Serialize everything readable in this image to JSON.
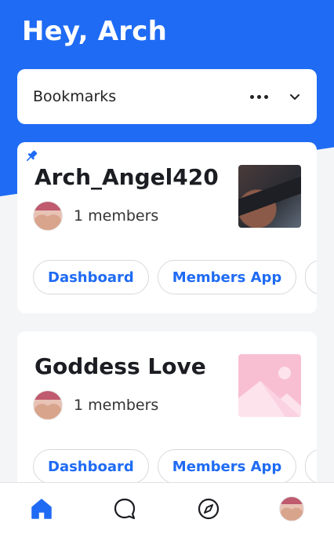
{
  "header": {
    "greeting": "Hey, Arch"
  },
  "selector": {
    "label": "Bookmarks",
    "more_icon": "more-icon",
    "chevron_icon": "chevron-down-icon"
  },
  "colors": {
    "brand": "#1f6bf4",
    "placeholder_pink": "#f8bfd3"
  },
  "cards": [
    {
      "title": "Arch_Angel420",
      "members": "1 members",
      "pinned": true,
      "pills": [
        "Dashboard",
        "Members App"
      ]
    },
    {
      "title": "Goddess Love",
      "members": "1 members",
      "pinned": false,
      "pills": [
        "Dashboard",
        "Members App"
      ]
    }
  ],
  "nav": {
    "items": [
      "home-icon",
      "chat-icon",
      "compass-icon",
      "profile-avatar"
    ],
    "active": "home-icon"
  }
}
